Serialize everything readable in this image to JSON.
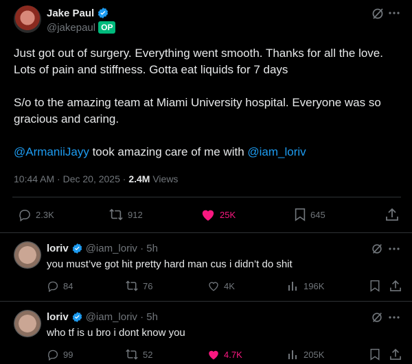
{
  "main_post": {
    "author": {
      "name": "Jake Paul",
      "handle": "@jakepaul",
      "badge": "OP"
    },
    "text": {
      "line1": "Just got out of surgery. Everything went smooth. Thanks for all the love.",
      "line2": "Lots of pain and stiffness. Gotta eat liquids for 7 days",
      "line3": "S/o to the amazing team at Miami University hospital. Everyone was so",
      "line4": "gracious and caring.",
      "mention1": "@ArmaniiJayy",
      "mid": " took amazing care of me with ",
      "mention2": "@iam_loriv"
    },
    "meta": {
      "time": "10:44 AM · Dec 20, 2025 · ",
      "views": "2.4M",
      "views_label": " Views"
    },
    "actions": {
      "replies": "2.3K",
      "reposts": "912",
      "likes": "25K",
      "bookmarks": "645"
    }
  },
  "replies": [
    {
      "name": "loriv",
      "handle": "@iam_loriv · 5h",
      "text": "you must’ve got hit pretty hard man cus i didn’t do shit",
      "actions": {
        "replies": "84",
        "reposts": "76",
        "likes": "4K",
        "views": "196K"
      },
      "liked": false
    },
    {
      "name": "loriv",
      "handle": "@iam_loriv · 5h",
      "text": "who tf is u bro i dont know you",
      "actions": {
        "replies": "99",
        "reposts": "52",
        "likes": "4.7K",
        "views": "205K"
      },
      "liked": true
    }
  ],
  "icons": {
    "verified": "verified-badge-icon",
    "grok": "grok-icon",
    "more": "more-icon",
    "reply": "reply-icon",
    "repost": "repost-icon",
    "like": "heart-icon",
    "bookmark": "bookmark-icon",
    "share": "share-icon",
    "views": "views-icon"
  },
  "colors": {
    "background": "#000000",
    "text": "#e7e9ea",
    "muted": "#71767b",
    "link": "#1d9bf0",
    "like": "#f91880",
    "op_badge": "#00ba7c",
    "verified": "#1d9bf0"
  }
}
